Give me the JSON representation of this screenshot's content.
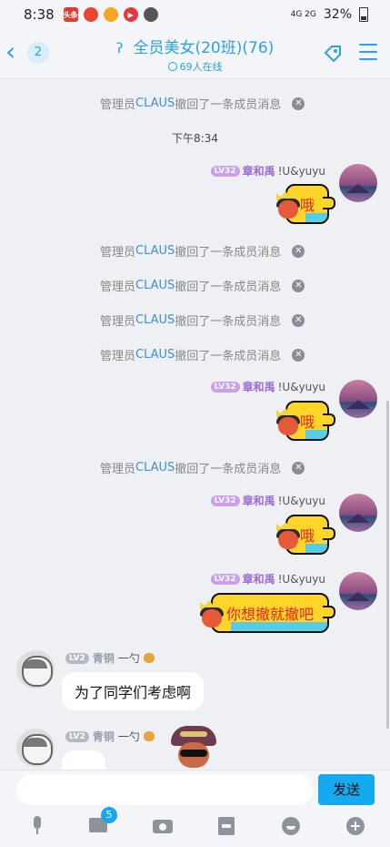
{
  "status_bar": {
    "time": "8:38",
    "battery": "32%",
    "network": "4G 2G",
    "app_icons": [
      "头条",
      "map-pin",
      "weibo",
      "video",
      "camera"
    ]
  },
  "header": {
    "back_count": "2",
    "title": "全员美女(20班)(76)",
    "online": "69人在线"
  },
  "messages": {
    "recall_prefix": "管理员",
    "recall_admin": "CLAUS",
    "recall_suffix": "撤回了一条成员消息",
    "timestamp": "下午8:34",
    "me_level": "LV32",
    "me_name": "章和禹",
    "me_suffix": "!U&yuyu",
    "me_msg1": "哦",
    "me_msg2": "哦",
    "me_msg3": "哦",
    "me_msg4": "你想撤就撤吧",
    "other_level": "LV2",
    "other_title": "青铜",
    "other_name": "一勺",
    "other_msg1": "为了同学们考虑啊"
  },
  "input_bar": {
    "send_label": "发送",
    "image_badge": "5"
  },
  "colors": {
    "accent": "#2aa2e6",
    "send": "#15aaf0",
    "bubble_yellow": "#ffd52a"
  }
}
